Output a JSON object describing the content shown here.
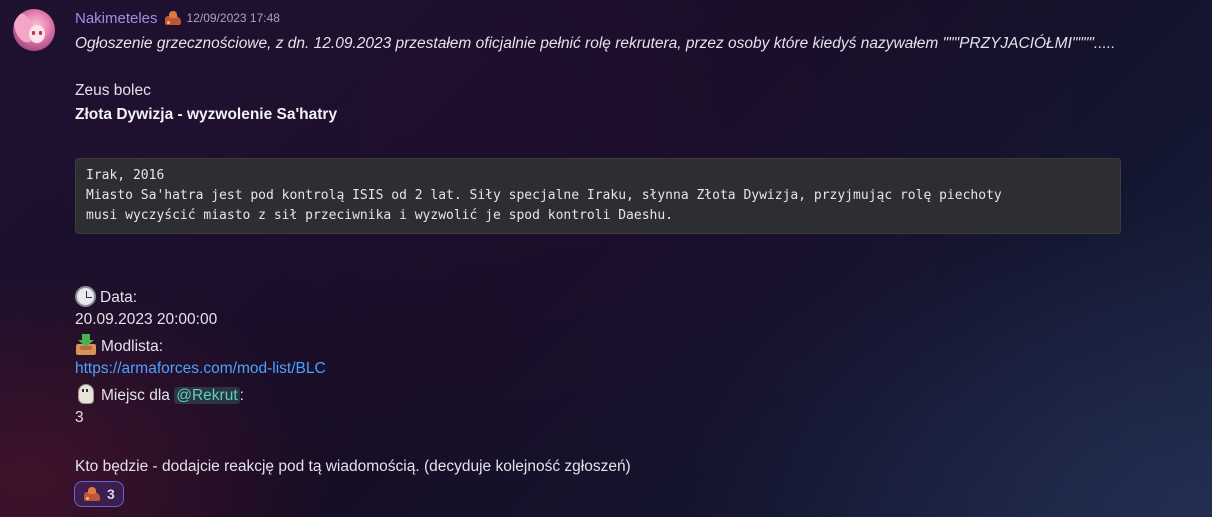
{
  "message": {
    "username": "Nakimeteles",
    "timestamp": "12/09/2023 17:48",
    "announcement": "Ogłoszenie grzecznościowe, z dn. 12.09.2023 przestałem oficjalnie pełnić rolę rekrutera, przez osoby które kiedyś nazywałem \"\"\"PRZYJACIÓŁMI\"\"\"\".....",
    "author_line": "Zeus bolec",
    "title": "Złota Dywizja - wyzwolenie  Sa'hatry",
    "code_lines": [
      "Irak, 2016",
      "Miasto Sa'hatra jest pod kontrolą ISIS od 2 lat. Siły specjalne Iraku, słynna Złota Dywizja, przyjmując rolę piechoty",
      "musi wyczyścić miasto z sił przeciwnika i wyzwolić je spod kontroli Daeshu."
    ],
    "date_label": "Data:",
    "date_value": "20.09.2023 20:00:00",
    "modlist_label": "Modlista:",
    "modlist_link": "https://armaforces.com/mod-list/BLC",
    "slots_label": "Miejsc dla",
    "slots_mention": "@Rekrut",
    "slots_colon": ":",
    "slots_value": "3",
    "footer_text": "Kto będzie - dodajcie reakcję pod tą wiadomością. (decyduje kolejność zgłoszeń)"
  },
  "reaction": {
    "emoji": "fire-cart-emoji",
    "count": "3"
  },
  "colors": {
    "username": "#a68ae6",
    "link": "#4aa3ff",
    "mention": "#56d6b2",
    "reaction_border": "#6c5fd6"
  }
}
